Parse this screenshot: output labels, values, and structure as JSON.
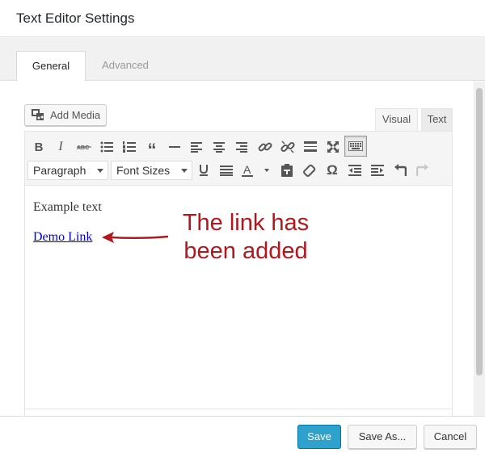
{
  "dialog": {
    "title": "Text Editor Settings"
  },
  "tabs": [
    {
      "label": "General",
      "active": true
    },
    {
      "label": "Advanced",
      "active": false
    }
  ],
  "editor": {
    "add_media_label": "Add Media",
    "mode_tabs": {
      "visual": "Visual",
      "text": "Text"
    },
    "format_select": "Paragraph",
    "font_size_select": "Font Sizes",
    "content_text": "Example text",
    "link_text": "Demo Link"
  },
  "annotation": {
    "line1": "The link has",
    "line2": "been added",
    "color": "#b0181e"
  },
  "toolbar_icons": {
    "row1": [
      "bold-icon",
      "italic-icon",
      "strikethrough-icon",
      "bullet-list-icon",
      "numbered-list-icon",
      "blockquote-icon",
      "horizontal-rule-icon",
      "align-left-icon",
      "align-center-icon",
      "align-right-icon",
      "insert-link-icon",
      "remove-link-icon",
      "read-more-icon",
      "fullscreen-icon",
      "toolbar-toggle-icon"
    ],
    "row2": [
      "underline-icon",
      "justify-icon",
      "text-color-icon",
      "paste-text-icon",
      "clear-formatting-icon",
      "special-character-icon",
      "outdent-icon",
      "indent-icon",
      "undo-icon",
      "redo-icon"
    ]
  },
  "footer": {
    "save_label": "Save",
    "save_as_label": "Save As...",
    "cancel_label": "Cancel"
  },
  "colors": {
    "primary_button": "#2ea2cc",
    "link": "#0000ee"
  }
}
